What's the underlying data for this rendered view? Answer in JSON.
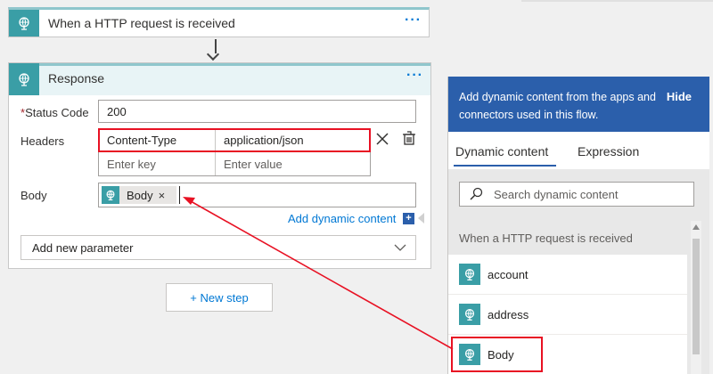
{
  "trigger": {
    "title": "When a HTTP request is received",
    "more_icon": "ellipsis-icon",
    "icon": "globe-icon"
  },
  "response": {
    "title": "Response",
    "more_icon": "ellipsis-icon",
    "icon": "globe-icon",
    "status_code": {
      "label": "Status Code",
      "required_mark": "*",
      "value": "200"
    },
    "headers": {
      "label": "Headers",
      "rows": [
        {
          "key": "Content-Type",
          "value": "application/json"
        },
        {
          "key_placeholder": "Enter key",
          "value_placeholder": "Enter value"
        }
      ]
    },
    "body": {
      "label": "Body",
      "token_label": "Body",
      "token_remove": "×"
    },
    "add_dynamic_content": "Add dynamic content",
    "add_dynamic_plus": "+",
    "add_new_parameter": "Add new parameter"
  },
  "new_step": "+ New step",
  "dynamic_panel": {
    "description": "Add dynamic content from the apps and connectors used in this flow.",
    "hide": "Hide",
    "tabs": [
      "Dynamic content",
      "Expression"
    ],
    "search_placeholder": "Search dynamic content",
    "section": "When a HTTP request is received",
    "items": [
      {
        "label": "account",
        "icon": "globe-icon"
      },
      {
        "label": "address",
        "icon": "globe-icon"
      },
      {
        "label": "Body",
        "icon": "globe-icon"
      }
    ]
  },
  "colors": {
    "accent_teal": "#3a9ea6",
    "brand_blue": "#2b5fab",
    "link_blue": "#0078d4",
    "highlight_red": "#e81123"
  }
}
